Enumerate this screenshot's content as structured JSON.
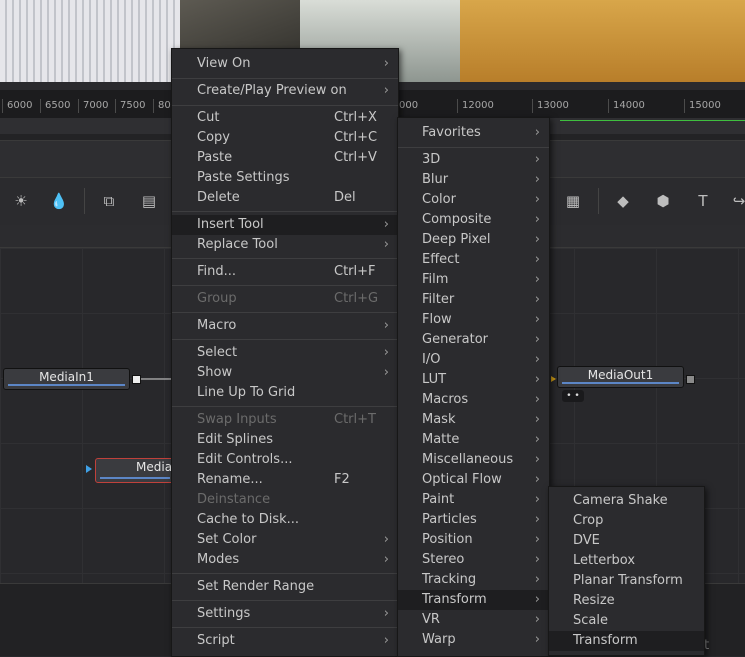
{
  "ruler": {
    "ticks": [
      "6000",
      "6500",
      "7000",
      "7500",
      "80",
      "000",
      "12000",
      "13000",
      "14000",
      "15000"
    ]
  },
  "toolbar_icons": [
    "brightness-icon",
    "color-drop-icon",
    "merge-icon",
    "channel-boolean-icon",
    "render-icon",
    "shape-icon",
    "text-3d-icon"
  ],
  "nodes": {
    "media_in1": "MediaIn1",
    "media_out1": "MediaOut1",
    "media_partial": "MediaI",
    "out_dots": "• •"
  },
  "context_menu": {
    "items": [
      {
        "label": "View On",
        "shortcut": "",
        "submenu": true,
        "disabled": false
      },
      {
        "label": "Create/Play Preview on",
        "shortcut": "",
        "submenu": true,
        "disabled": false
      },
      {
        "label": "Cut",
        "shortcut": "Ctrl+X",
        "submenu": false,
        "disabled": false
      },
      {
        "label": "Copy",
        "shortcut": "Ctrl+C",
        "submenu": false,
        "disabled": false
      },
      {
        "label": "Paste",
        "shortcut": "Ctrl+V",
        "submenu": false,
        "disabled": false
      },
      {
        "label": "Paste Settings",
        "shortcut": "",
        "submenu": false,
        "disabled": false
      },
      {
        "label": "Delete",
        "shortcut": "Del",
        "submenu": false,
        "disabled": false
      },
      {
        "label": "Insert Tool",
        "shortcut": "",
        "submenu": true,
        "disabled": false,
        "highlighted": true
      },
      {
        "label": "Replace Tool",
        "shortcut": "",
        "submenu": true,
        "disabled": false
      },
      {
        "label": "Find...",
        "shortcut": "Ctrl+F",
        "submenu": false,
        "disabled": false
      },
      {
        "label": "Group",
        "shortcut": "Ctrl+G",
        "submenu": false,
        "disabled": true
      },
      {
        "label": "Macro",
        "shortcut": "",
        "submenu": true,
        "disabled": false
      },
      {
        "label": "Select",
        "shortcut": "",
        "submenu": true,
        "disabled": false
      },
      {
        "label": "Show",
        "shortcut": "",
        "submenu": true,
        "disabled": false
      },
      {
        "label": "Line Up To Grid",
        "shortcut": "",
        "submenu": false,
        "disabled": false
      },
      {
        "label": "Swap Inputs",
        "shortcut": "Ctrl+T",
        "submenu": false,
        "disabled": true
      },
      {
        "label": "Edit Splines",
        "shortcut": "",
        "submenu": false,
        "disabled": false
      },
      {
        "label": "Edit Controls...",
        "shortcut": "",
        "submenu": false,
        "disabled": false
      },
      {
        "label": "Rename...",
        "shortcut": "F2",
        "submenu": false,
        "disabled": false
      },
      {
        "label": "Deinstance",
        "shortcut": "",
        "submenu": false,
        "disabled": true
      },
      {
        "label": "Cache to Disk...",
        "shortcut": "",
        "submenu": false,
        "disabled": false
      },
      {
        "label": "Set Color",
        "shortcut": "",
        "submenu": true,
        "disabled": false
      },
      {
        "label": "Modes",
        "shortcut": "",
        "submenu": true,
        "disabled": false
      },
      {
        "label": "Set Render Range",
        "shortcut": "",
        "submenu": false,
        "disabled": false
      },
      {
        "label": "Settings",
        "shortcut": "",
        "submenu": true,
        "disabled": false
      },
      {
        "label": "Script",
        "shortcut": "",
        "submenu": true,
        "disabled": false
      }
    ]
  },
  "insert_tool_menu": {
    "items": [
      {
        "label": "Favorites",
        "highlighted": false
      },
      {
        "label": "3D",
        "highlighted": false
      },
      {
        "label": "Blur",
        "highlighted": false
      },
      {
        "label": "Color",
        "highlighted": false
      },
      {
        "label": "Composite",
        "highlighted": false
      },
      {
        "label": "Deep Pixel",
        "highlighted": false
      },
      {
        "label": "Effect",
        "highlighted": false
      },
      {
        "label": "Film",
        "highlighted": false
      },
      {
        "label": "Filter",
        "highlighted": false
      },
      {
        "label": "Flow",
        "highlighted": false
      },
      {
        "label": "Generator",
        "highlighted": false
      },
      {
        "label": "I/O",
        "highlighted": false
      },
      {
        "label": "LUT",
        "highlighted": false
      },
      {
        "label": "Macros",
        "highlighted": false
      },
      {
        "label": "Mask",
        "highlighted": false
      },
      {
        "label": "Matte",
        "highlighted": false
      },
      {
        "label": "Miscellaneous",
        "highlighted": false
      },
      {
        "label": "Optical Flow",
        "highlighted": false
      },
      {
        "label": "Paint",
        "highlighted": false
      },
      {
        "label": "Particles",
        "highlighted": false
      },
      {
        "label": "Position",
        "highlighted": false
      },
      {
        "label": "Stereo",
        "highlighted": false
      },
      {
        "label": "Tracking",
        "highlighted": false
      },
      {
        "label": "Transform",
        "highlighted": true
      },
      {
        "label": "VR",
        "highlighted": false
      },
      {
        "label": "Warp",
        "highlighted": false
      }
    ]
  },
  "transform_menu": {
    "items": [
      {
        "label": "Camera Shake",
        "highlighted": false
      },
      {
        "label": "Crop",
        "highlighted": false
      },
      {
        "label": "DVE",
        "highlighted": false
      },
      {
        "label": "Letterbox",
        "highlighted": false
      },
      {
        "label": "Planar Transform",
        "highlighted": false
      },
      {
        "label": "Resize",
        "highlighted": false
      },
      {
        "label": "Scale",
        "highlighted": false
      },
      {
        "label": "Transform",
        "highlighted": true
      }
    ]
  },
  "bottom_partial_text": "t",
  "colors": {
    "menu_bg": "#2b2b2e",
    "highlight_bg": "#1e1e20",
    "node_bar": "#5c86c6",
    "selected_node_border": "#c0413b",
    "timeline_green": "#3fbf3f"
  }
}
